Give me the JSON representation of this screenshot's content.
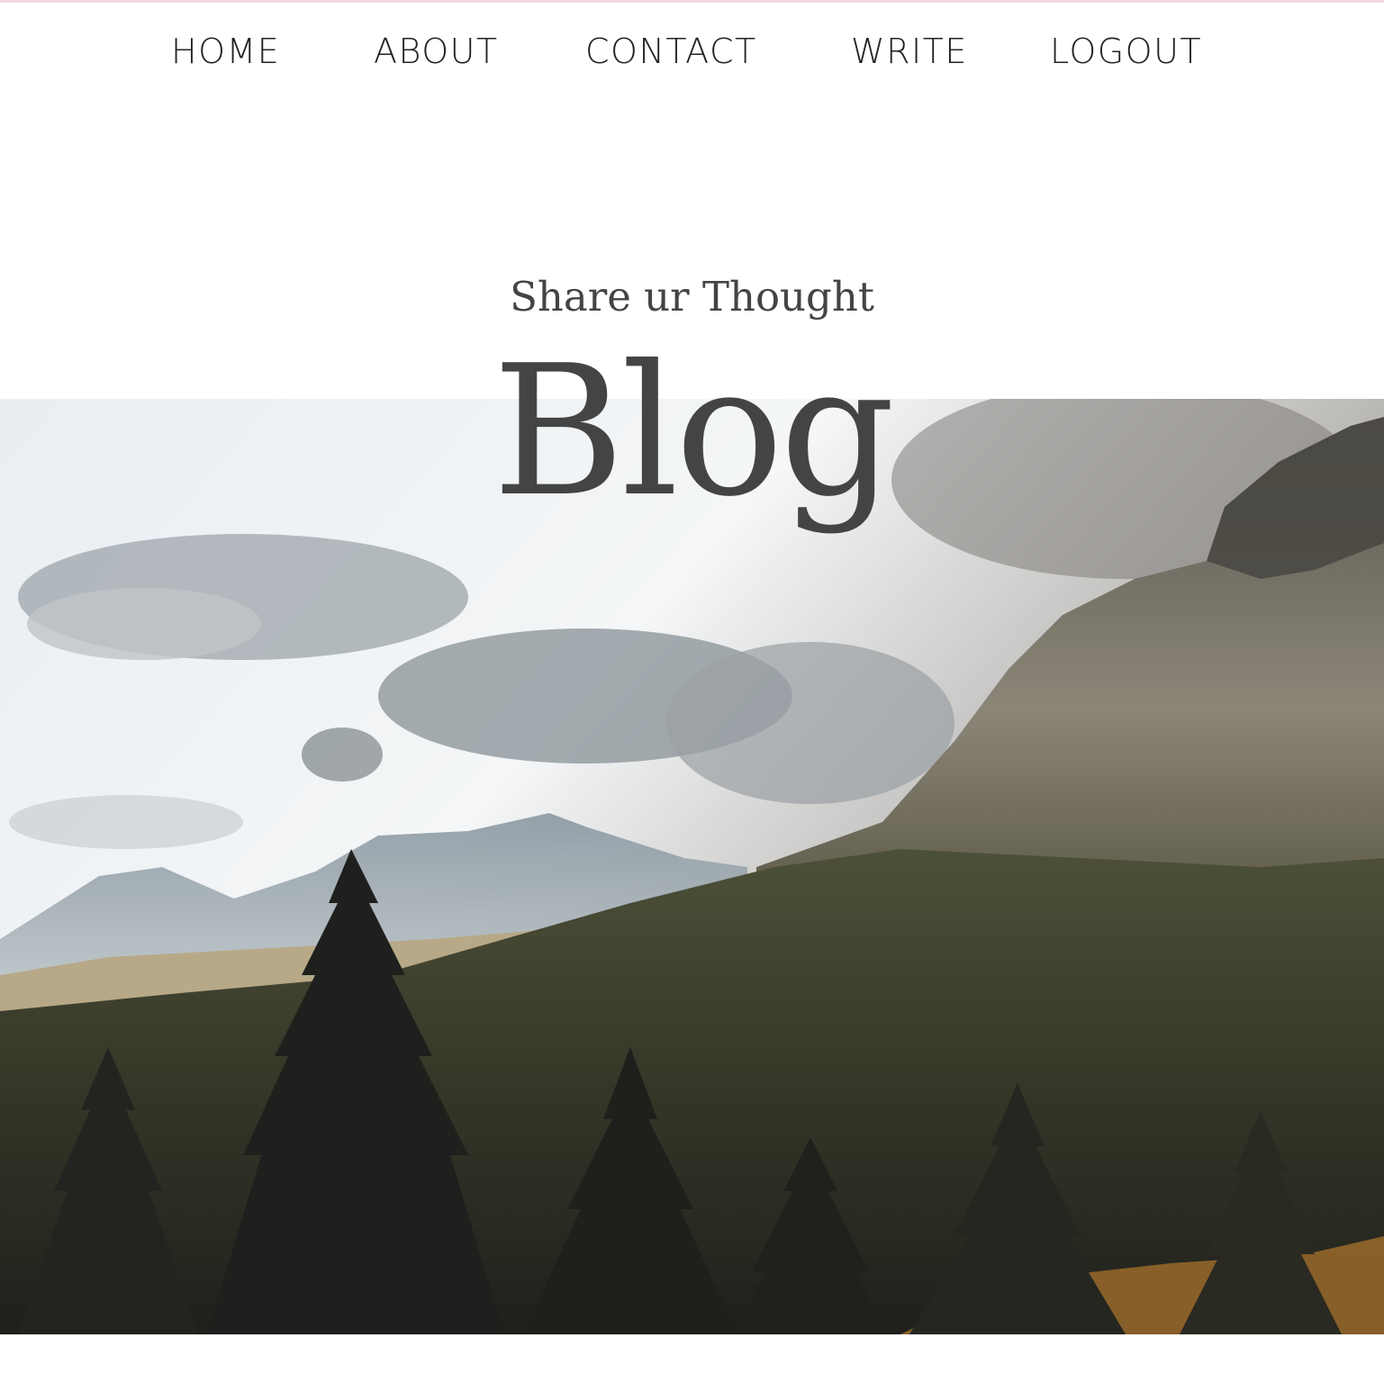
{
  "nav": {
    "items": [
      {
        "label": "HOME"
      },
      {
        "label": "ABOUT"
      },
      {
        "label": "CONTACT"
      },
      {
        "label": "WRITE"
      },
      {
        "label": "LOGOUT"
      }
    ]
  },
  "header": {
    "subtitle": "Share ur Thought",
    "title": "Blog"
  },
  "hero_image": {
    "icon": "mountain-forest-landscape"
  },
  "colors": {
    "accent_bar": "#f6d9dc",
    "title_text": "#444444",
    "nav_text": "#222222"
  }
}
